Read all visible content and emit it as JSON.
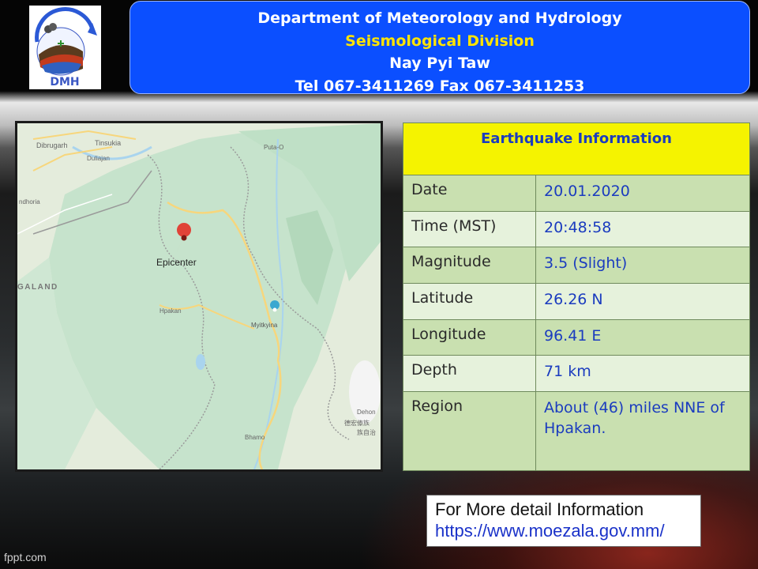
{
  "header": {
    "line1": "Department of Meteorology and Hydrology",
    "line2": "Seismological  Division",
    "line3": "Nay Pyi Taw",
    "line4": "Tel 067-3411269  Fax 067-3411253"
  },
  "logo": {
    "text": "DMH",
    "icon": "dmh-logo-icon"
  },
  "map": {
    "marker_label": "Epicenter",
    "places": {
      "dibrugarh": "Dibrugarh",
      "tinsukia": "Tinsukia",
      "duliajan": "Duliajan",
      "putao": "Puta-O",
      "ndhoria": "ndhoria",
      "galand": "GALAND",
      "hpakan": "Hpakan",
      "myitkyina": "Myitkyina",
      "dehong": "Dehon",
      "bhamo": "Bhamo",
      "cjk1": "德宏傣族",
      "cjk2": "族自治"
    },
    "icons": [
      "epicenter-pin-icon",
      "city-pin-icon"
    ],
    "colors": {
      "land": "#dfe9d8",
      "forest": "#bfe0c6",
      "road": "#f7d67c",
      "border": "#9a9a9a",
      "water": "#a9d4ee",
      "pin": "#e04338"
    }
  },
  "eq": {
    "title": "Earthquake Information",
    "rows": [
      {
        "label": "Date",
        "value": "20.01.2020"
      },
      {
        "label": "Time (MST)",
        "value": "20:48:58"
      },
      {
        "label": "Magnitude",
        "value": "3.5 (Slight)"
      },
      {
        "label": "Latitude",
        "value": "26.26 N"
      },
      {
        "label": "Longitude",
        "value": "96.41 E"
      },
      {
        "label": "Depth",
        "value": "71 km"
      },
      {
        "label": "Region",
        "value": "About (46) miles NNE of Hpakan."
      }
    ]
  },
  "info": {
    "line1": "For More detail Information",
    "line2": "https://www.moezala.gov.mm/"
  },
  "footer": {
    "watermark": "fppt.com"
  },
  "colors": {
    "header_bg": "#0b4fff",
    "header_accent": "#ffe400",
    "table_title_bg": "#f5f300",
    "table_value": "#1b3cbf"
  }
}
